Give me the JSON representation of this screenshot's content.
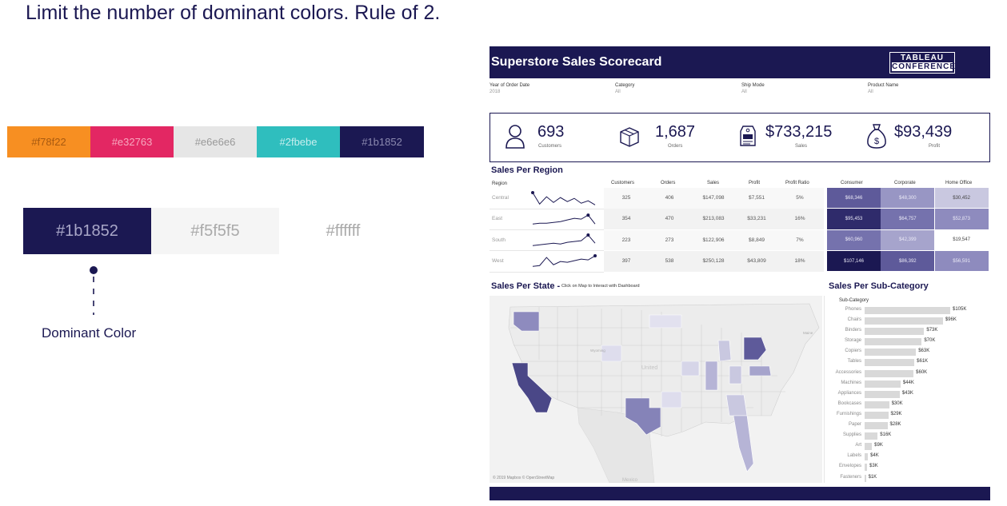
{
  "slide": {
    "title": "Limit the number of dominant colors. Rule of 2.",
    "palette": [
      {
        "hex": "#f78f22",
        "label": "#f78f22"
      },
      {
        "hex": "#e32763",
        "label": "#e32763"
      },
      {
        "hex": "#e6e6e6",
        "label": "#e6e6e6"
      },
      {
        "hex": "#2fbebe",
        "label": "#2fbebe"
      },
      {
        "hex": "#1b1852",
        "label": "#1b1852"
      }
    ],
    "dominant": [
      {
        "hex": "#1b1852",
        "label": "#1b1852"
      },
      {
        "hex": "#f5f5f5",
        "label": "#f5f5f5"
      },
      {
        "hex": "#ffffff",
        "label": "#ffffff"
      }
    ],
    "dominant_label": "Dominant Color"
  },
  "dashboard": {
    "title": "Superstore Sales Scorecard",
    "logo_line1": "TABLEAU",
    "logo_line2": "CONFERENCE",
    "filters": [
      {
        "label": "Year of Order Date",
        "value": "2018"
      },
      {
        "label": "Category",
        "value": "All"
      },
      {
        "label": "Ship Mode",
        "value": "All"
      },
      {
        "label": "Product Name",
        "value": "All"
      }
    ],
    "kpis": [
      {
        "icon": "person-icon",
        "value": "693",
        "label": "Customers"
      },
      {
        "icon": "box-icon",
        "value": "1,687",
        "label": "Orders"
      },
      {
        "icon": "sale-tag-icon",
        "value": "$733,215",
        "label": "Sales"
      },
      {
        "icon": "money-bag-icon",
        "value": "$93,439",
        "label": "Profit"
      }
    ],
    "region": {
      "title": "Sales Per Region",
      "headers": [
        "Region",
        "Customers",
        "Orders",
        "Sales",
        "Profit",
        "Profit Ratio"
      ],
      "segments": [
        "Consumer",
        "Corporate",
        "Home Office"
      ],
      "rows": [
        {
          "region": "Central",
          "customers": "325",
          "orders": "406",
          "sales": "$147,098",
          "profit": "$7,551",
          "ratio": "5%",
          "consumer": "$68,346",
          "corporate": "$48,300",
          "home": "$30,452",
          "spark": [
            0.85,
            0.15,
            0.6,
            0.25,
            0.55,
            0.3,
            0.5,
            0.2,
            0.35,
            0.1
          ]
        },
        {
          "region": "East",
          "customers": "354",
          "orders": "470",
          "sales": "$213,083",
          "profit": "$33,231",
          "ratio": "16%",
          "consumer": "$95,453",
          "corporate": "$64,757",
          "home": "$52,873",
          "spark": [
            0.2,
            0.25,
            0.25,
            0.3,
            0.35,
            0.45,
            0.55,
            0.5,
            0.75,
            0.2
          ]
        },
        {
          "region": "South",
          "customers": "223",
          "orders": "273",
          "sales": "$122,906",
          "profit": "$8,849",
          "ratio": "7%",
          "consumer": "$60,960",
          "corporate": "$42,399",
          "home": "$19,547",
          "spark": [
            0.2,
            0.25,
            0.3,
            0.35,
            0.3,
            0.4,
            0.45,
            0.5,
            0.85,
            0.35
          ]
        },
        {
          "region": "West",
          "customers": "397",
          "orders": "538",
          "sales": "$250,128",
          "profit": "$43,809",
          "ratio": "18%",
          "consumer": "$107,146",
          "corporate": "$86,392",
          "home": "$56,591",
          "spark": [
            0.2,
            0.25,
            0.75,
            0.3,
            0.5,
            0.45,
            0.55,
            0.65,
            0.6,
            0.85
          ]
        }
      ],
      "segment_colors": [
        [
          "#5e5a9a",
          "#9896c4",
          "#c9c8e0"
        ],
        [
          "#2f2b6b",
          "#7572ad",
          "#8e8bbe"
        ],
        [
          "#7572ad",
          "#a6a4cc",
          "#ffffff"
        ],
        [
          "#1b1852",
          "#5e5a9a",
          "#8e8bbe"
        ]
      ]
    },
    "state": {
      "title": "Sales Per State -",
      "subtitle": "Click on Map to Interact with Dashboard",
      "map_credit": "© 2019 Mapbox © OpenStreetMap",
      "map_labels": [
        "Wyoming",
        "United",
        "Mexico",
        "Maine"
      ]
    },
    "subcat": {
      "title": "Sales Per Sub-Category",
      "header": "Sub-Category",
      "rows": [
        {
          "name": "Phones",
          "value": 105,
          "label": "$105K"
        },
        {
          "name": "Chairs",
          "value": 96,
          "label": "$96K"
        },
        {
          "name": "Binders",
          "value": 73,
          "label": "$73K"
        },
        {
          "name": "Storage",
          "value": 70,
          "label": "$70K"
        },
        {
          "name": "Copiers",
          "value": 63,
          "label": "$63K"
        },
        {
          "name": "Tables",
          "value": 61,
          "label": "$61K"
        },
        {
          "name": "Accessories",
          "value": 60,
          "label": "$60K"
        },
        {
          "name": "Machines",
          "value": 44,
          "label": "$44K"
        },
        {
          "name": "Appliances",
          "value": 43,
          "label": "$43K"
        },
        {
          "name": "Bookcases",
          "value": 30,
          "label": "$30K"
        },
        {
          "name": "Furnishings",
          "value": 29,
          "label": "$29K"
        },
        {
          "name": "Paper",
          "value": 28,
          "label": "$28K"
        },
        {
          "name": "Supplies",
          "value": 16,
          "label": "$16K"
        },
        {
          "name": "Art",
          "value": 9,
          "label": "$9K"
        },
        {
          "name": "Labels",
          "value": 4,
          "label": "$4K"
        },
        {
          "name": "Envelopes",
          "value": 3,
          "label": "$3K"
        },
        {
          "name": "Fasteners",
          "value": 1,
          "label": "$1K"
        }
      ]
    }
  }
}
